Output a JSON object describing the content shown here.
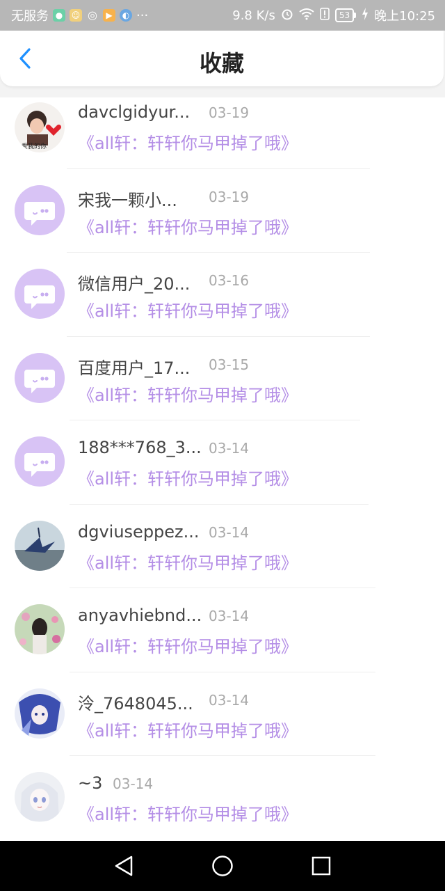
{
  "status_bar": {
    "carrier": "无服务",
    "speed": "9.8 K/s",
    "battery": "53",
    "time": "晚上10:25",
    "more": "···"
  },
  "header": {
    "title": "收藏",
    "back_icon": "chevron-left-icon",
    "accent_color": "#1e90ff"
  },
  "items": [
    {
      "username": "davclgidyur...",
      "date": "03-19",
      "title": "《all轩：轩轩你马甲掉了哦》",
      "avatar": "photo-boy-heart"
    },
    {
      "username": "宋我一颗小...",
      "date": "03-19",
      "title": "《all轩：轩轩你马甲掉了哦》",
      "avatar": "default-chat-bubble"
    },
    {
      "username": "微信用户_20...",
      "date": "03-16",
      "title": "《all轩：轩轩你马甲掉了哦》",
      "avatar": "default-chat-bubble"
    },
    {
      "username": "百度用户_17...",
      "date": "03-15",
      "title": "《all轩：轩轩你马甲掉了哦》",
      "avatar": "default-chat-bubble"
    },
    {
      "username": "188***768_3...",
      "date": "03-14",
      "title": "《all轩：轩轩你马甲掉了哦》",
      "avatar": "default-chat-bubble"
    },
    {
      "username": "dgviuseppez...",
      "date": "03-14",
      "title": "《all轩：轩轩你马甲掉了哦》",
      "avatar": "photo-paper-crane"
    },
    {
      "username": "anyavhiebnd...",
      "date": "03-14",
      "title": "《all轩：轩轩你马甲掉了哦》",
      "avatar": "photo-girl-flowers"
    },
    {
      "username": "泠_7648045...",
      "date": "03-14",
      "title": "《all轩：轩轩你马甲掉了哦》",
      "avatar": "photo-anime-blue"
    },
    {
      "username": "~3",
      "date": "03-14",
      "title": "《all轩：轩轩你马甲掉了哦》",
      "avatar": "photo-anime-white"
    }
  ],
  "colors": {
    "title_purple": "#b48ee6",
    "placeholder_avatar": "#d8c3f5"
  },
  "nav": {
    "back": "triangle-back-icon",
    "home": "circle-home-icon",
    "recents": "square-recents-icon"
  }
}
